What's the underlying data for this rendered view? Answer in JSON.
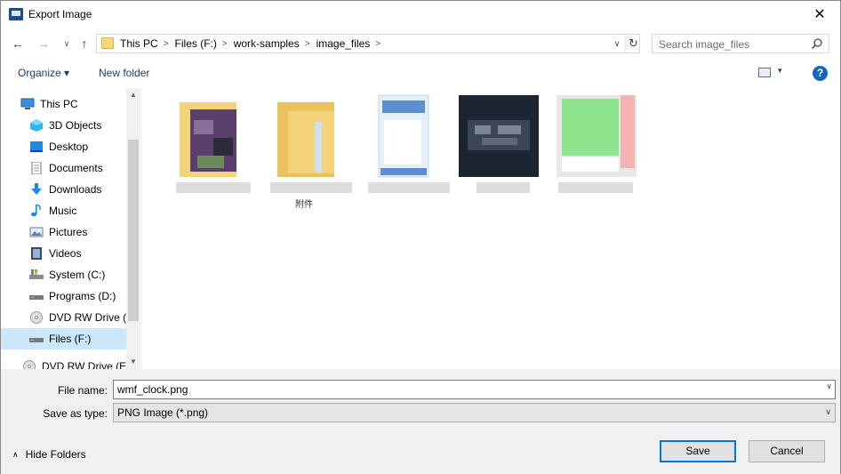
{
  "window": {
    "title": "Export Image",
    "close_glyph": "✕"
  },
  "nav": {
    "back_glyph": "←",
    "forward_glyph": "→",
    "recent_glyph": "∨",
    "up_glyph": "↑",
    "breadcrumbs": [
      "This PC",
      "Files (F:)",
      "work-samples",
      "image_files"
    ],
    "crumb_sep": ">",
    "addr_dropdown_glyph": "∨",
    "refresh_glyph": "↻",
    "search_placeholder": "Search image_files"
  },
  "toolbar": {
    "organize_label": "Organize ▾",
    "new_folder_label": "New folder",
    "view_dropdown_glyph": "▾",
    "help_glyph": "?"
  },
  "sidebar": {
    "items": [
      {
        "label": "This PC",
        "icon": "computer-icon"
      },
      {
        "label": "3D Objects",
        "icon": "cube-icon"
      },
      {
        "label": "Desktop",
        "icon": "desktop-icon"
      },
      {
        "label": "Documents",
        "icon": "document-icon"
      },
      {
        "label": "Downloads",
        "icon": "download-icon"
      },
      {
        "label": "Music",
        "icon": "music-icon"
      },
      {
        "label": "Pictures",
        "icon": "pictures-icon"
      },
      {
        "label": "Videos",
        "icon": "video-icon"
      },
      {
        "label": "System (C:)",
        "icon": "system-drive-icon"
      },
      {
        "label": "Programs (D:)",
        "icon": "drive-icon"
      },
      {
        "label": "DVD RW Drive (E",
        "icon": "dvd-icon"
      },
      {
        "label": "Files (F:)",
        "icon": "drive-icon",
        "selected": true
      },
      {
        "label": "DVD RW Drive (E:)",
        "icon": "dvd-icon"
      }
    ],
    "scroll_up_glyph": "▲",
    "scroll_down_glyph": "▼"
  },
  "files": {
    "items": [
      {
        "kind": "folder",
        "thumb_colors": [
          "#5a3e6b",
          "#8a6f99",
          "#2d2a3a"
        ]
      },
      {
        "kind": "folder",
        "thumb_colors": [
          "#f4d27a",
          "#cfe0f0",
          "#e9c25e"
        ]
      },
      {
        "kind": "image",
        "thumb_colors": [
          "#e6eef8",
          "#5b8fd0",
          "#ffffff"
        ]
      },
      {
        "kind": "image",
        "thumb_colors": [
          "#1c2430",
          "#7b8594",
          "#3a4556"
        ]
      },
      {
        "kind": "image",
        "thumb_colors": [
          "#8ee58e",
          "#f3b3b3",
          "#e8e8e8"
        ]
      }
    ],
    "partial_caption": "附件"
  },
  "form": {
    "file_name_label": "File name:",
    "file_name_value": "wmf_clock.png",
    "save_type_label": "Save as type:",
    "save_type_value": "PNG Image (*.png)",
    "dropdown_glyph": "∨"
  },
  "footer": {
    "hide_folders_label": "Hide Folders",
    "hide_folders_glyph": "∧",
    "save_label": "Save",
    "cancel_label": "Cancel"
  }
}
